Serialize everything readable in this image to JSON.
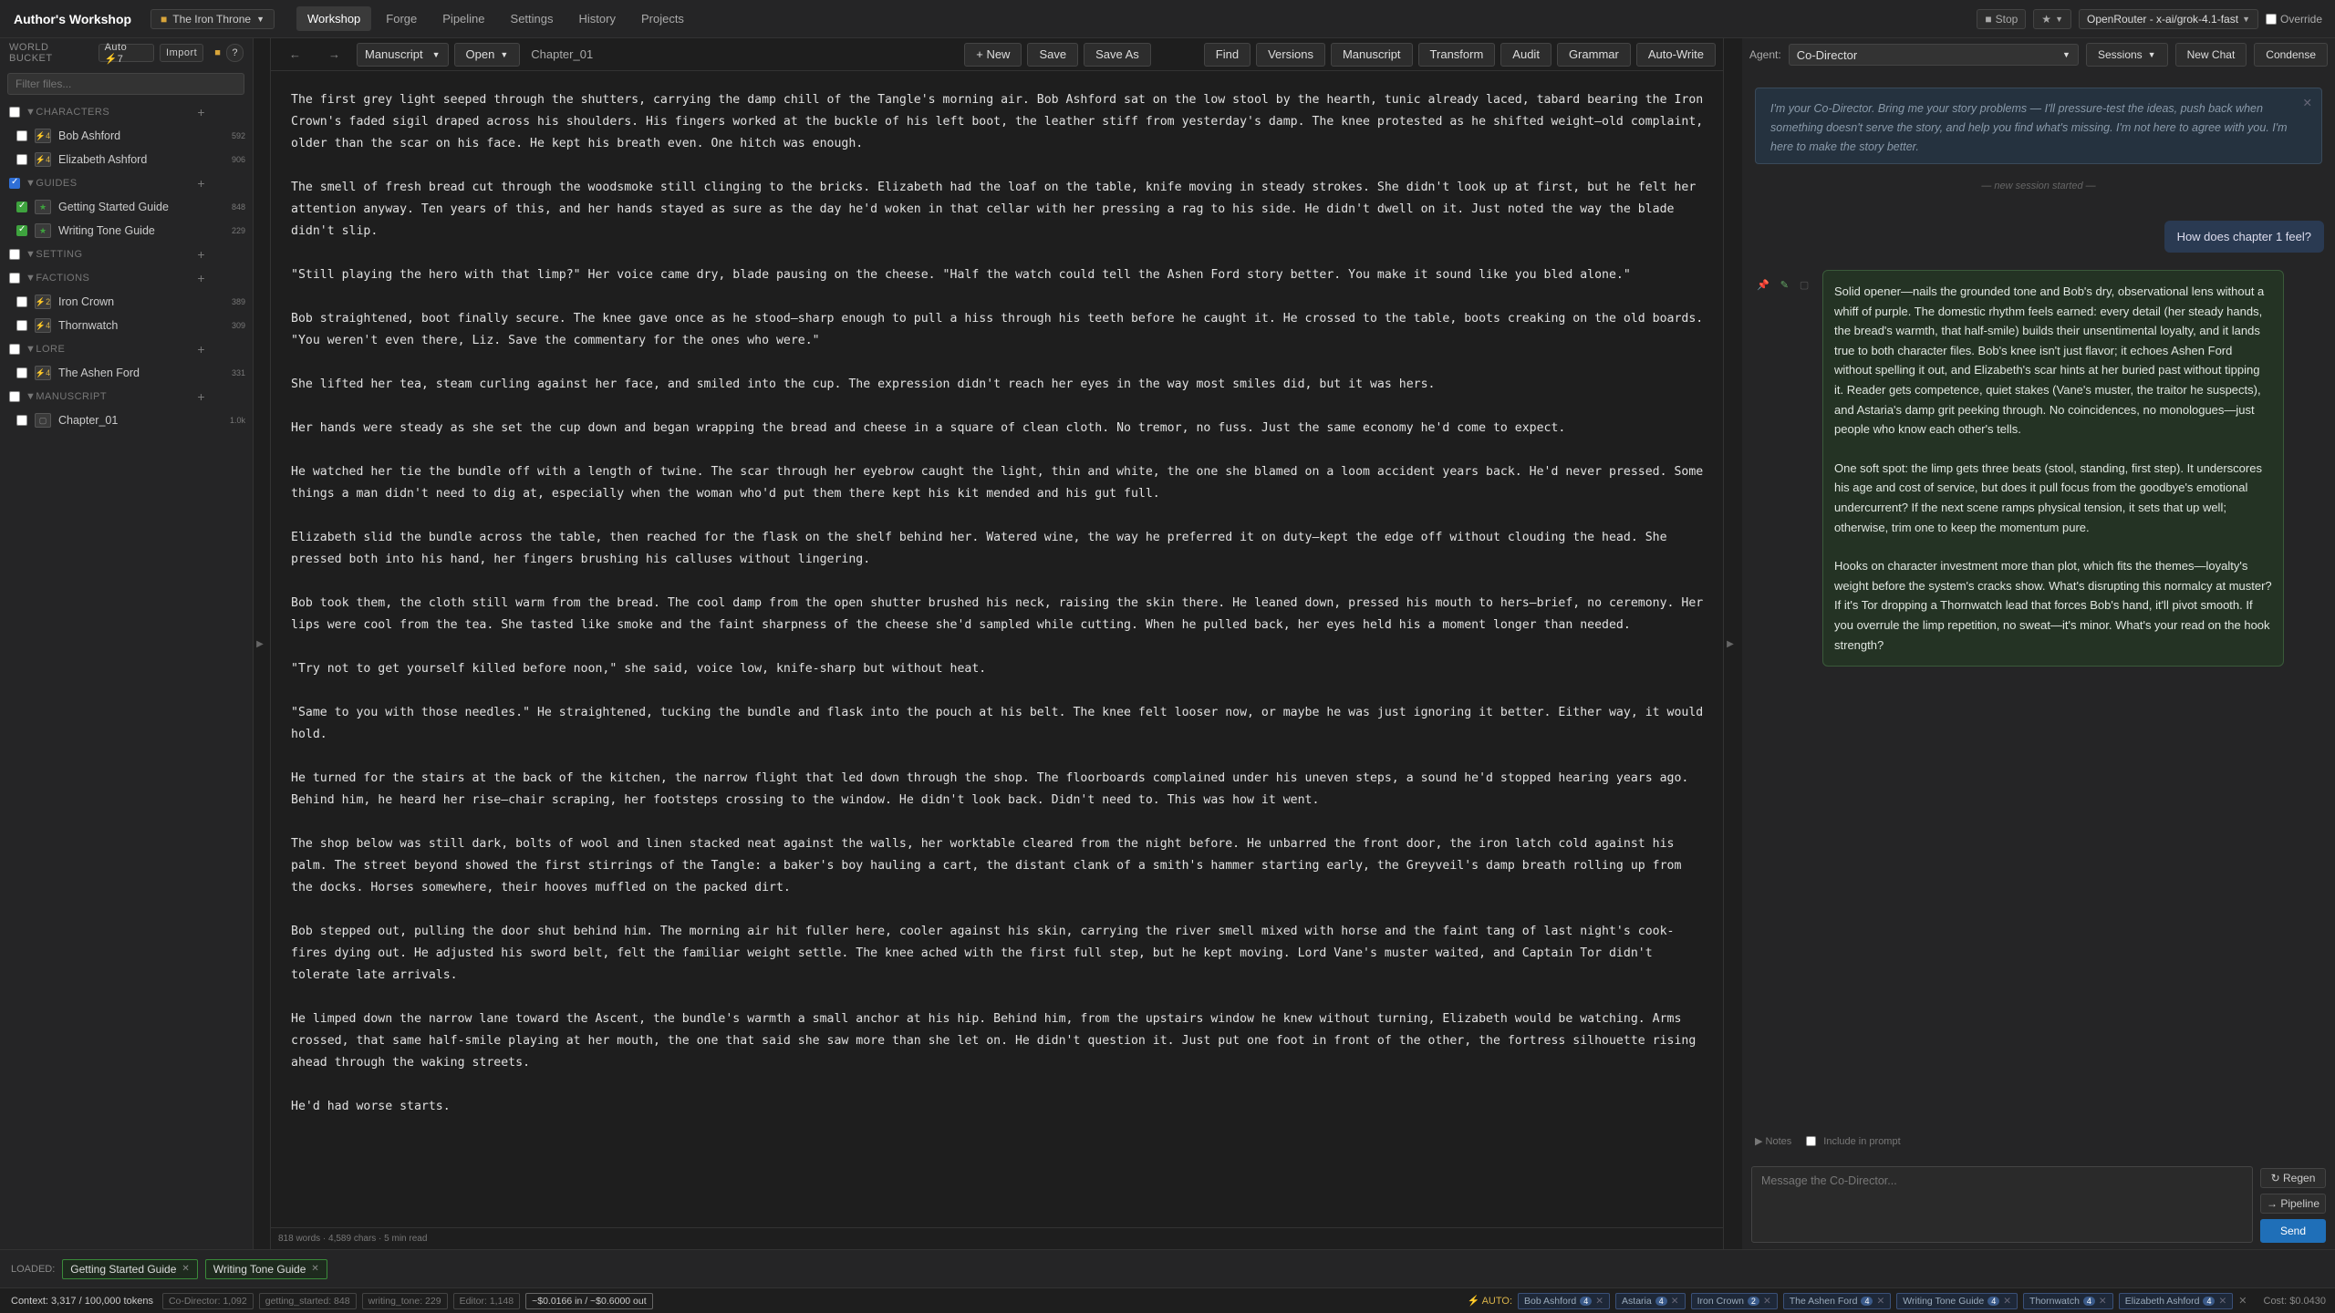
{
  "app": {
    "title": "Author's Workshop",
    "project": "The Iron Throne"
  },
  "nav": {
    "tabs": [
      "Workshop",
      "Forge",
      "Pipeline",
      "Settings",
      "History",
      "Projects"
    ]
  },
  "topright": {
    "stop": "Stop",
    "star": "★",
    "model": "OpenRouter - x-ai/grok-4.1-fast",
    "override": "Override"
  },
  "sidebar": {
    "header": "WORLD BUCKET",
    "auto": "Auto ⚡7",
    "import": "Import",
    "help": "?",
    "filter_placeholder": "Filter files...",
    "categories": [
      {
        "name": "CHARACTERS",
        "items": [
          {
            "name": "Bob Ashford",
            "count": "592"
          },
          {
            "name": "Elizabeth Ashford",
            "count": "906"
          }
        ]
      },
      {
        "name": "GUIDES",
        "items": [
          {
            "name": "Getting Started Guide",
            "count": "848"
          },
          {
            "name": "Writing Tone Guide",
            "count": "229"
          }
        ]
      },
      {
        "name": "SETTING",
        "items": []
      },
      {
        "name": "FACTIONS",
        "items": [
          {
            "name": "Iron Crown",
            "count": "389"
          },
          {
            "name": "Thornwatch",
            "count": "309"
          }
        ]
      },
      {
        "name": "LORE",
        "items": [
          {
            "name": "The Ashen Ford",
            "count": "331"
          }
        ]
      },
      {
        "name": "MANUSCRIPT",
        "items": [
          {
            "name": "Chapter_01",
            "count": "1.0k"
          }
        ]
      }
    ]
  },
  "editor": {
    "back": "←",
    "fwd": "→",
    "mode": "Manuscript",
    "open": "Open",
    "filename": "Chapter_01",
    "buttons": [
      "+ New",
      "Save",
      "Save As"
    ],
    "tools": [
      "Find",
      "Versions",
      "Manuscript",
      "Transform",
      "Audit",
      "Grammar",
      "Auto-Write"
    ],
    "status": "818 words · 4,589 chars · 5 min read",
    "paragraphs": [
      "The first grey light seeped through the shutters, carrying the damp chill of the Tangle's morning air. Bob Ashford sat on the low stool by the hearth, tunic already laced, tabard bearing the Iron Crown's faded sigil draped across his shoulders. His fingers worked at the buckle of his left boot, the leather stiff from yesterday's damp. The knee protested as he shifted weight—old complaint, older than the scar on his face. He kept his breath even. One hitch was enough.",
      "The smell of fresh bread cut through the woodsmoke still clinging to the bricks. Elizabeth had the loaf on the table, knife moving in steady strokes. She didn't look up at first, but he felt her attention anyway. Ten years of this, and her hands stayed as sure as the day he'd woken in that cellar with her pressing a rag to his side. He didn't dwell on it. Just noted the way the blade didn't slip.",
      "\"Still playing the hero with that limp?\" Her voice came dry, blade pausing on the cheese. \"Half the watch could tell the Ashen Ford story better. You make it sound like you bled alone.\"",
      "Bob straightened, boot finally secure. The knee gave once as he stood—sharp enough to pull a hiss through his teeth before he caught it. He crossed to the table, boots creaking on the old boards. \"You weren't even there, Liz. Save the commentary for the ones who were.\"",
      "She lifted her tea, steam curling against her face, and smiled into the cup. The expression didn't reach her eyes in the way most smiles did, but it was hers.",
      "Her hands were steady as she set the cup down and began wrapping the bread and cheese in a square of clean cloth. No tremor, no fuss. Just the same economy he'd come to expect.",
      "He watched her tie the bundle off with a length of twine. The scar through her eyebrow caught the light, thin and white, the one she blamed on a loom accident years back. He'd never pressed. Some things a man didn't need to dig at, especially when the woman who'd put them there kept his kit mended and his gut full.",
      "Elizabeth slid the bundle across the table, then reached for the flask on the shelf behind her. Watered wine, the way he preferred it on duty—kept the edge off without clouding the head. She pressed both into his hand, her fingers brushing his calluses without lingering.",
      "Bob took them, the cloth still warm from the bread. The cool damp from the open shutter brushed his neck, raising the skin there. He leaned down, pressed his mouth to hers—brief, no ceremony. Her lips were cool from the tea. She tasted like smoke and the faint sharpness of the cheese she'd sampled while cutting. When he pulled back, her eyes held his a moment longer than needed.",
      "\"Try not to get yourself killed before noon,\" she said, voice low, knife-sharp but without heat.",
      "\"Same to you with those needles.\" He straightened, tucking the bundle and flask into the pouch at his belt. The knee felt looser now, or maybe he was just ignoring it better. Either way, it would hold.",
      "He turned for the stairs at the back of the kitchen, the narrow flight that led down through the shop. The floorboards complained under his uneven steps, a sound he'd stopped hearing years ago. Behind him, he heard her rise—chair scraping, her footsteps crossing to the window. He didn't look back. Didn't need to. This was how it went.",
      "The shop below was still dark, bolts of wool and linen stacked neat against the walls, her worktable cleared from the night before. He unbarred the front door, the iron latch cold against his palm. The street beyond showed the first stirrings of the Tangle: a baker's boy hauling a cart, the distant clank of a smith's hammer starting early, the Greyveil's damp breath rolling up from the docks. Horses somewhere, their hooves muffled on the packed dirt.",
      "Bob stepped out, pulling the door shut behind him. The morning air hit fuller here, cooler against his skin, carrying the river smell mixed with horse and the faint tang of last night's cook-fires dying out. He adjusted his sword belt, felt the familiar weight settle. The knee ached with the first full step, but he kept moving. Lord Vane's muster waited, and Captain Tor didn't tolerate late arrivals.",
      "He limped down the narrow lane toward the Ascent, the bundle's warmth a small anchor at his hip. Behind him, from the upstairs window he knew without turning, Elizabeth would be watching. Arms crossed, that same half-smile playing at her mouth, the one that said she saw more than she let on. He didn't question it. Just put one foot in front of the other, the fortress silhouette rising ahead through the waking streets.",
      "He'd had worse starts."
    ]
  },
  "right": {
    "agent_label": "Agent:",
    "agent": "Co-Director",
    "sessions": "Sessions",
    "new_chat": "New Chat",
    "condense": "Condense",
    "intro": "I'm your Co-Director. Bring me your story problems — I'll pressure-test the ideas, push back when something doesn't serve the story, and help you find what's missing. I'm not here to agree with you. I'm here to make the story better.",
    "session_marker": "— new session started —",
    "user_msg": "How does chapter 1 feel?",
    "assistant": [
      "Solid opener—nails the grounded tone and Bob's dry, observational lens without a whiff of purple. The domestic rhythm feels earned: every detail (her steady hands, the bread's warmth, that half-smile) builds their unsentimental loyalty, and it lands true to both character files. Bob's knee isn't just flavor; it echoes Ashen Ford without spelling it out, and Elizabeth's scar hints at her buried past without tipping it. Reader gets competence, quiet stakes (Vane's muster, the traitor he suspects), and Astaria's damp grit peeking through. No coincidences, no monologues—just people who know each other's tells.",
      "One soft spot: the limp gets three beats (stool, standing, first step). It underscores his age and cost of service, but does it pull focus from the goodbye's emotional undercurrent? If the next scene ramps physical tension, it sets that up well; otherwise, trim one to keep the momentum pure.",
      "Hooks on character investment more than plot, which fits the themes—loyalty's weight before the system's cracks show. What's disrupting this normalcy at muster? If it's Tor dropping a Thornwatch lead that forces Bob's hand, it'll pivot smooth. If you overrule the limp repetition, no sweat—it's minor. What's your read on the hook strength?"
    ],
    "notes": "▶ Notes",
    "include": "Include in prompt",
    "input_placeholder": "Message the Co-Director...",
    "regen": "↻ Regen",
    "pipeline": "→ Pipeline",
    "send": "Send"
  },
  "loaded": {
    "label": "LOADED:",
    "chips": [
      "Getting Started Guide",
      "Writing Tone Guide"
    ]
  },
  "footer": {
    "context": "Context: 3,317 / 100,000 tokens",
    "chips": [
      "Co-Director: 1,092",
      "getting_started: 848",
      "writing_tone: 229",
      "Editor: 1,148",
      "~$0.0166 in / ~$0.6000 out"
    ],
    "auto_label": "⚡ AUTO:",
    "auto_chips": [
      {
        "name": "Bob Ashford",
        "n": "4"
      },
      {
        "name": "Astaria",
        "n": "4"
      },
      {
        "name": "Iron Crown",
        "n": "2"
      },
      {
        "name": "The Ashen Ford",
        "n": "4"
      },
      {
        "name": "Writing Tone Guide",
        "n": "4"
      },
      {
        "name": "Thornwatch",
        "n": "4"
      },
      {
        "name": "Elizabeth Ashford",
        "n": "4"
      }
    ],
    "cost": "Cost: $0.0430"
  },
  "colors": {
    "accent": "#1f6fb8",
    "green": "#3ea33e",
    "bg": "#1e1e1e",
    "panel": "#252526"
  }
}
